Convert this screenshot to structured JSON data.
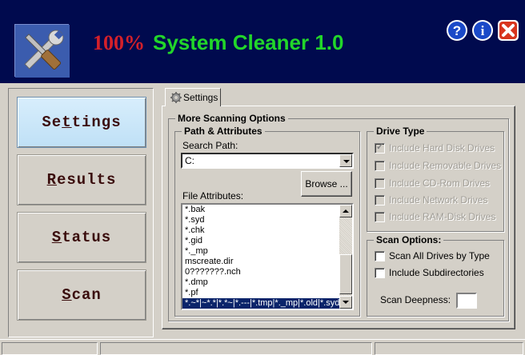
{
  "header": {
    "title_percent": "100%",
    "title_name": "System Cleaner 1.0",
    "buttons": [
      {
        "icon": "help-icon",
        "color": "#1a49c8"
      },
      {
        "icon": "info-icon",
        "color": "#1a49c8"
      },
      {
        "icon": "close-icon",
        "color": "#d9351e"
      }
    ]
  },
  "nav": {
    "settings_pre": "Se",
    "settings_u": "t",
    "settings_post": "tings",
    "results_u": "R",
    "results_post": "esults",
    "status_u": "S",
    "status_post": "tatus",
    "scan_u": "S",
    "scan_post": "can"
  },
  "tabs": {
    "settings_label": "Settings"
  },
  "options": {
    "group_title": "More Scanning Options",
    "path_group_title": "Path & Attributes",
    "search_path_label": "Search Path:",
    "search_path_value": "C:",
    "browse_label": "Browse ...",
    "file_attributes_label": "File Attributes:",
    "file_attributes": [
      "*.bak",
      "*.syd",
      "*.chk",
      "*.gid",
      "*._mp",
      "mscreate.dir",
      "0???????.nch",
      "*.dmp",
      "*.pf",
      "*.~*|~*.*|*.*~|*.---|*.tmp|*._mp|*.old|*.syd|*.c"
    ]
  },
  "drive_type": {
    "title": "Drive Type",
    "items": [
      {
        "label": "Include Hard Disk Drives",
        "checked": true
      },
      {
        "label": "Include Removable Drives",
        "checked": false
      },
      {
        "label": "Include CD-Rom Drives",
        "checked": false
      },
      {
        "label": "Include Network Drives",
        "checked": false
      },
      {
        "label": "Include RAM-Disk Drives",
        "checked": false
      }
    ]
  },
  "scan_options": {
    "title": "Scan Options:",
    "scan_all_label": "Scan All Drives by Type",
    "include_sub_label": "Include Subdirectories",
    "deepness_label": "Scan Deepness:",
    "deepness_value": ""
  }
}
